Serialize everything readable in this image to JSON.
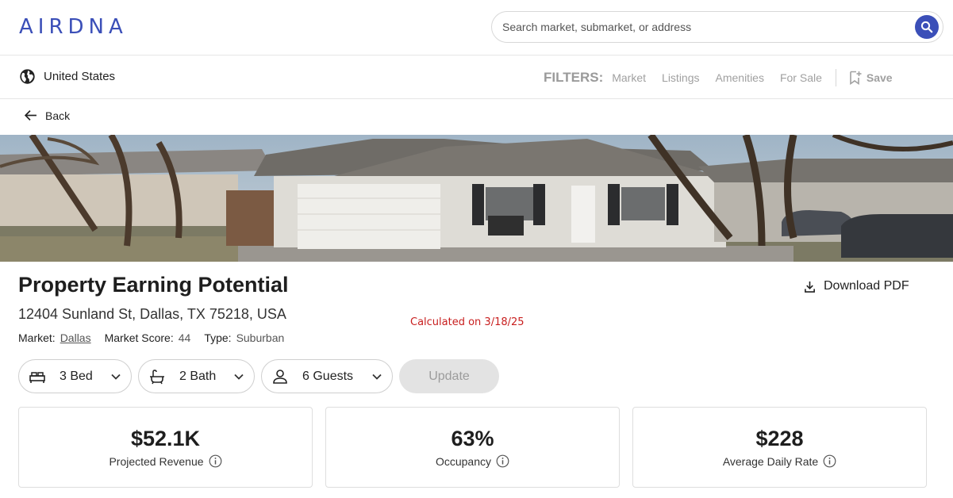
{
  "header": {
    "logo": "AIRDNA",
    "search": {
      "placeholder": "Search market, submarket, or address"
    }
  },
  "subbar": {
    "country": "United States",
    "filters_title": "FILTERS:",
    "filters": [
      "Market",
      "Listings",
      "Amenities",
      "For Sale"
    ],
    "save_label": "Save"
  },
  "nav": {
    "back_label": "Back"
  },
  "property": {
    "title": "Property Earning Potential",
    "address": "12404 Sunland St, Dallas, TX 75218, USA",
    "calculated": "Calculated on 3/18/25",
    "download_label": "Download PDF",
    "market_label": "Market:",
    "market_value": "Dallas",
    "score_label": "Market Score:",
    "score_value": "44",
    "type_label": "Type:",
    "type_value": "Suburban"
  },
  "selectors": {
    "bed": "3 Bed",
    "bath": "2 Bath",
    "guests": "6 Guests",
    "update_label": "Update"
  },
  "metrics": [
    {
      "value": "$52.1K",
      "label": "Projected Revenue"
    },
    {
      "value": "63%",
      "label": "Occupancy"
    },
    {
      "value": "$228",
      "label": "Average Daily Rate"
    }
  ],
  "colors": {
    "brand": "#3b4fb8",
    "calc_text": "#c81e1e"
  }
}
